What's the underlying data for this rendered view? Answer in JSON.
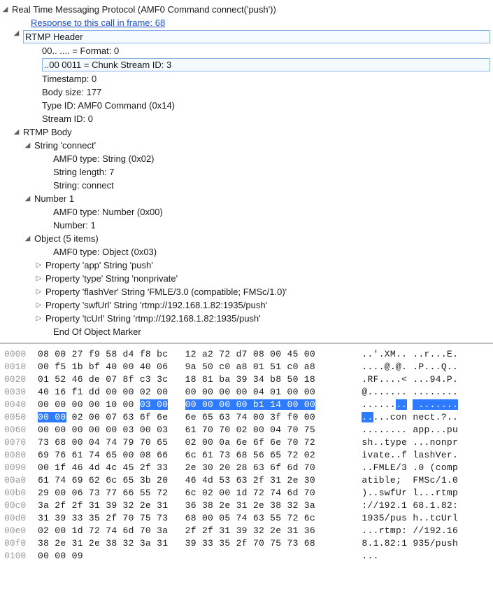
{
  "tree": {
    "root_label": "Real Time Messaging Protocol (AMF0 Command connect('push'))",
    "response_link": "Response to this call in frame: 68",
    "header_label": "RTMP Header",
    "header_fields": {
      "format": "00.. .... = Format: 0",
      "chunk_stream": "..00 0011 = Chunk Stream ID: 3",
      "timestamp": "Timestamp: 0",
      "body_size": "Body size: 177",
      "type_id": "Type ID: AMF0 Command (0x14)",
      "stream_id": "Stream ID: 0"
    },
    "body_label": "RTMP Body",
    "string_section": {
      "label": "String 'connect'",
      "amf_type": "AMF0 type: String (0x02)",
      "length": "String length: 7",
      "value": "String: connect"
    },
    "number_section": {
      "label": "Number 1",
      "amf_type": "AMF0 type: Number (0x00)",
      "value": "Number: 1"
    },
    "object_section": {
      "label": "Object (5 items)",
      "amf_type": "AMF0 type: Object (0x03)",
      "props": [
        "Property 'app' String 'push'",
        "Property 'type' String 'nonprivate'",
        "Property 'flashVer' String 'FMLE/3.0 (compatible; FMSc/1.0)'",
        "Property 'swfUrl' String 'rtmp://192.168.1.82:1935/push'",
        "Property 'tcUrl' String 'rtmp://192.168.1.82:1935/push'"
      ],
      "end": "End Of Object Marker"
    }
  },
  "hex": [
    {
      "off": "0000",
      "b1": "08 00 27 f9 58 d4 f8 bc",
      "b2": "12 a2 72 d7 08 00 45 00",
      "a1": "..'.XM..",
      "a2": "..r...E."
    },
    {
      "off": "0010",
      "b1": "00 f5 1b bf 40 00 40 06",
      "b2": "9a 50 c0 a8 01 51 c0 a8",
      "a1": "....@.@.",
      "a2": ".P...Q.."
    },
    {
      "off": "0020",
      "b1": "01 52 46 de 07 8f c3 3c",
      "b2": "18 81 ba 39 34 b8 50 18",
      "a1": ".RF....<",
      "a2": "...94.P."
    },
    {
      "off": "0030",
      "b1": "40 16 f1 dd 00 00 02 00",
      "b2": "00 00 00 00 04 01 00 00",
      "a1": "@.......",
      "a2": "........"
    },
    {
      "off": "0040",
      "b1": "00 00 00 00 10 00 ",
      "b1h": "03 00",
      "b2h": "00 00 00 00 b1 14 00 00",
      "a1": "......",
      "a1h": "..",
      "a2h": " ......."
    },
    {
      "off": "0050",
      "b1h": "00 00",
      "b1": " 02 00 07 63 6f 6e",
      "b2": "6e 65 63 74 00 3f f0 00",
      "a1h": "..",
      "a1": "...con",
      "a2": "nect.?.."
    },
    {
      "off": "0060",
      "b1": "00 00 00 00 00 03 00 03",
      "b2": "61 70 70 02 00 04 70 75",
      "a1": "........",
      "a2": "app...pu"
    },
    {
      "off": "0070",
      "b1": "73 68 00 04 74 79 70 65",
      "b2": "02 00 0a 6e 6f 6e 70 72",
      "a1": "sh..type",
      "a2": "...nonpr"
    },
    {
      "off": "0080",
      "b1": "69 76 61 74 65 00 08 66",
      "b2": "6c 61 73 68 56 65 72 02",
      "a1": "ivate..f",
      "a2": "lashVer."
    },
    {
      "off": "0090",
      "b1": "00 1f 46 4d 4c 45 2f 33",
      "b2": "2e 30 20 28 63 6f 6d 70",
      "a1": "..FMLE/3",
      "a2": ".0 (comp"
    },
    {
      "off": "00a0",
      "b1": "61 74 69 62 6c 65 3b 20",
      "b2": "46 4d 53 63 2f 31 2e 30",
      "a1": "atible; ",
      "a2": "FMSc/1.0"
    },
    {
      "off": "00b0",
      "b1": "29 00 06 73 77 66 55 72",
      "b2": "6c 02 00 1d 72 74 6d 70",
      "a1": ")..swfUr",
      "a2": "l...rtmp"
    },
    {
      "off": "00c0",
      "b1": "3a 2f 2f 31 39 32 2e 31",
      "b2": "36 38 2e 31 2e 38 32 3a",
      "a1": "://192.1",
      "a2": "68.1.82:"
    },
    {
      "off": "00d0",
      "b1": "31 39 33 35 2f 70 75 73",
      "b2": "68 00 05 74 63 55 72 6c",
      "a1": "1935/pus",
      "a2": "h..tcUrl"
    },
    {
      "off": "00e0",
      "b1": "02 00 1d 72 74 6d 70 3a",
      "b2": "2f 2f 31 39 32 2e 31 36",
      "a1": "...rtmp:",
      "a2": "//192.16"
    },
    {
      "off": "00f0",
      "b1": "38 2e 31 2e 38 32 3a 31",
      "b2": "39 33 35 2f 70 75 73 68",
      "a1": "8.1.82:1",
      "a2": "935/push"
    },
    {
      "off": "0100",
      "b1": "00 00 09",
      "b2": "",
      "a1": "...",
      "a2": ""
    }
  ]
}
